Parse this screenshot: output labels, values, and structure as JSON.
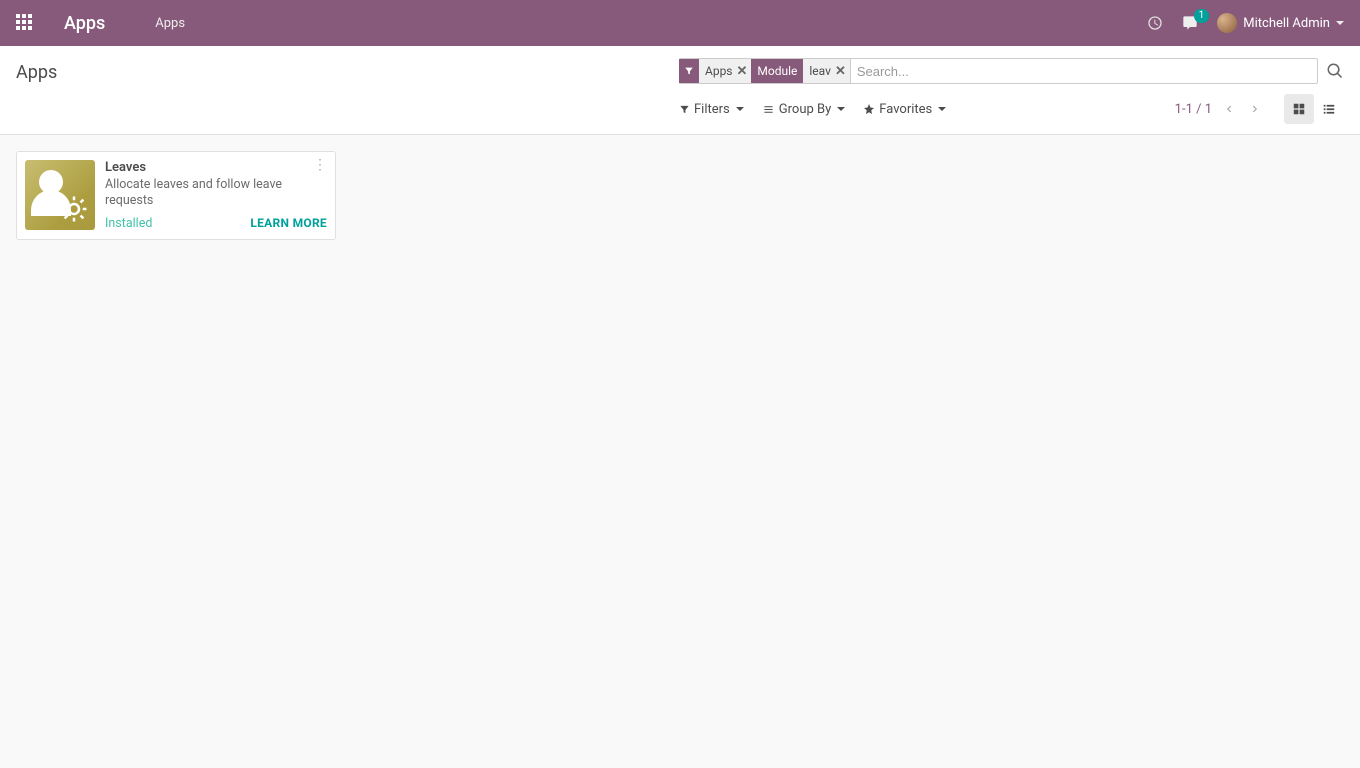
{
  "navbar": {
    "brand": "Apps",
    "menu_apps": "Apps",
    "notification_count": "1",
    "user_name": "Mitchell Admin"
  },
  "control": {
    "title": "Apps",
    "search_placeholder": "Search...",
    "facets": [
      {
        "label_icon": "filter",
        "value": "Apps"
      },
      {
        "label_text": "Module",
        "value": "leav"
      }
    ],
    "filters_label": "Filters",
    "groupby_label": "Group By",
    "favorites_label": "Favorites",
    "pager": "1-1 / 1"
  },
  "cards": [
    {
      "title": "Leaves",
      "desc": "Allocate leaves and follow leave requests",
      "status": "Installed",
      "learn": "LEARN MORE"
    }
  ]
}
